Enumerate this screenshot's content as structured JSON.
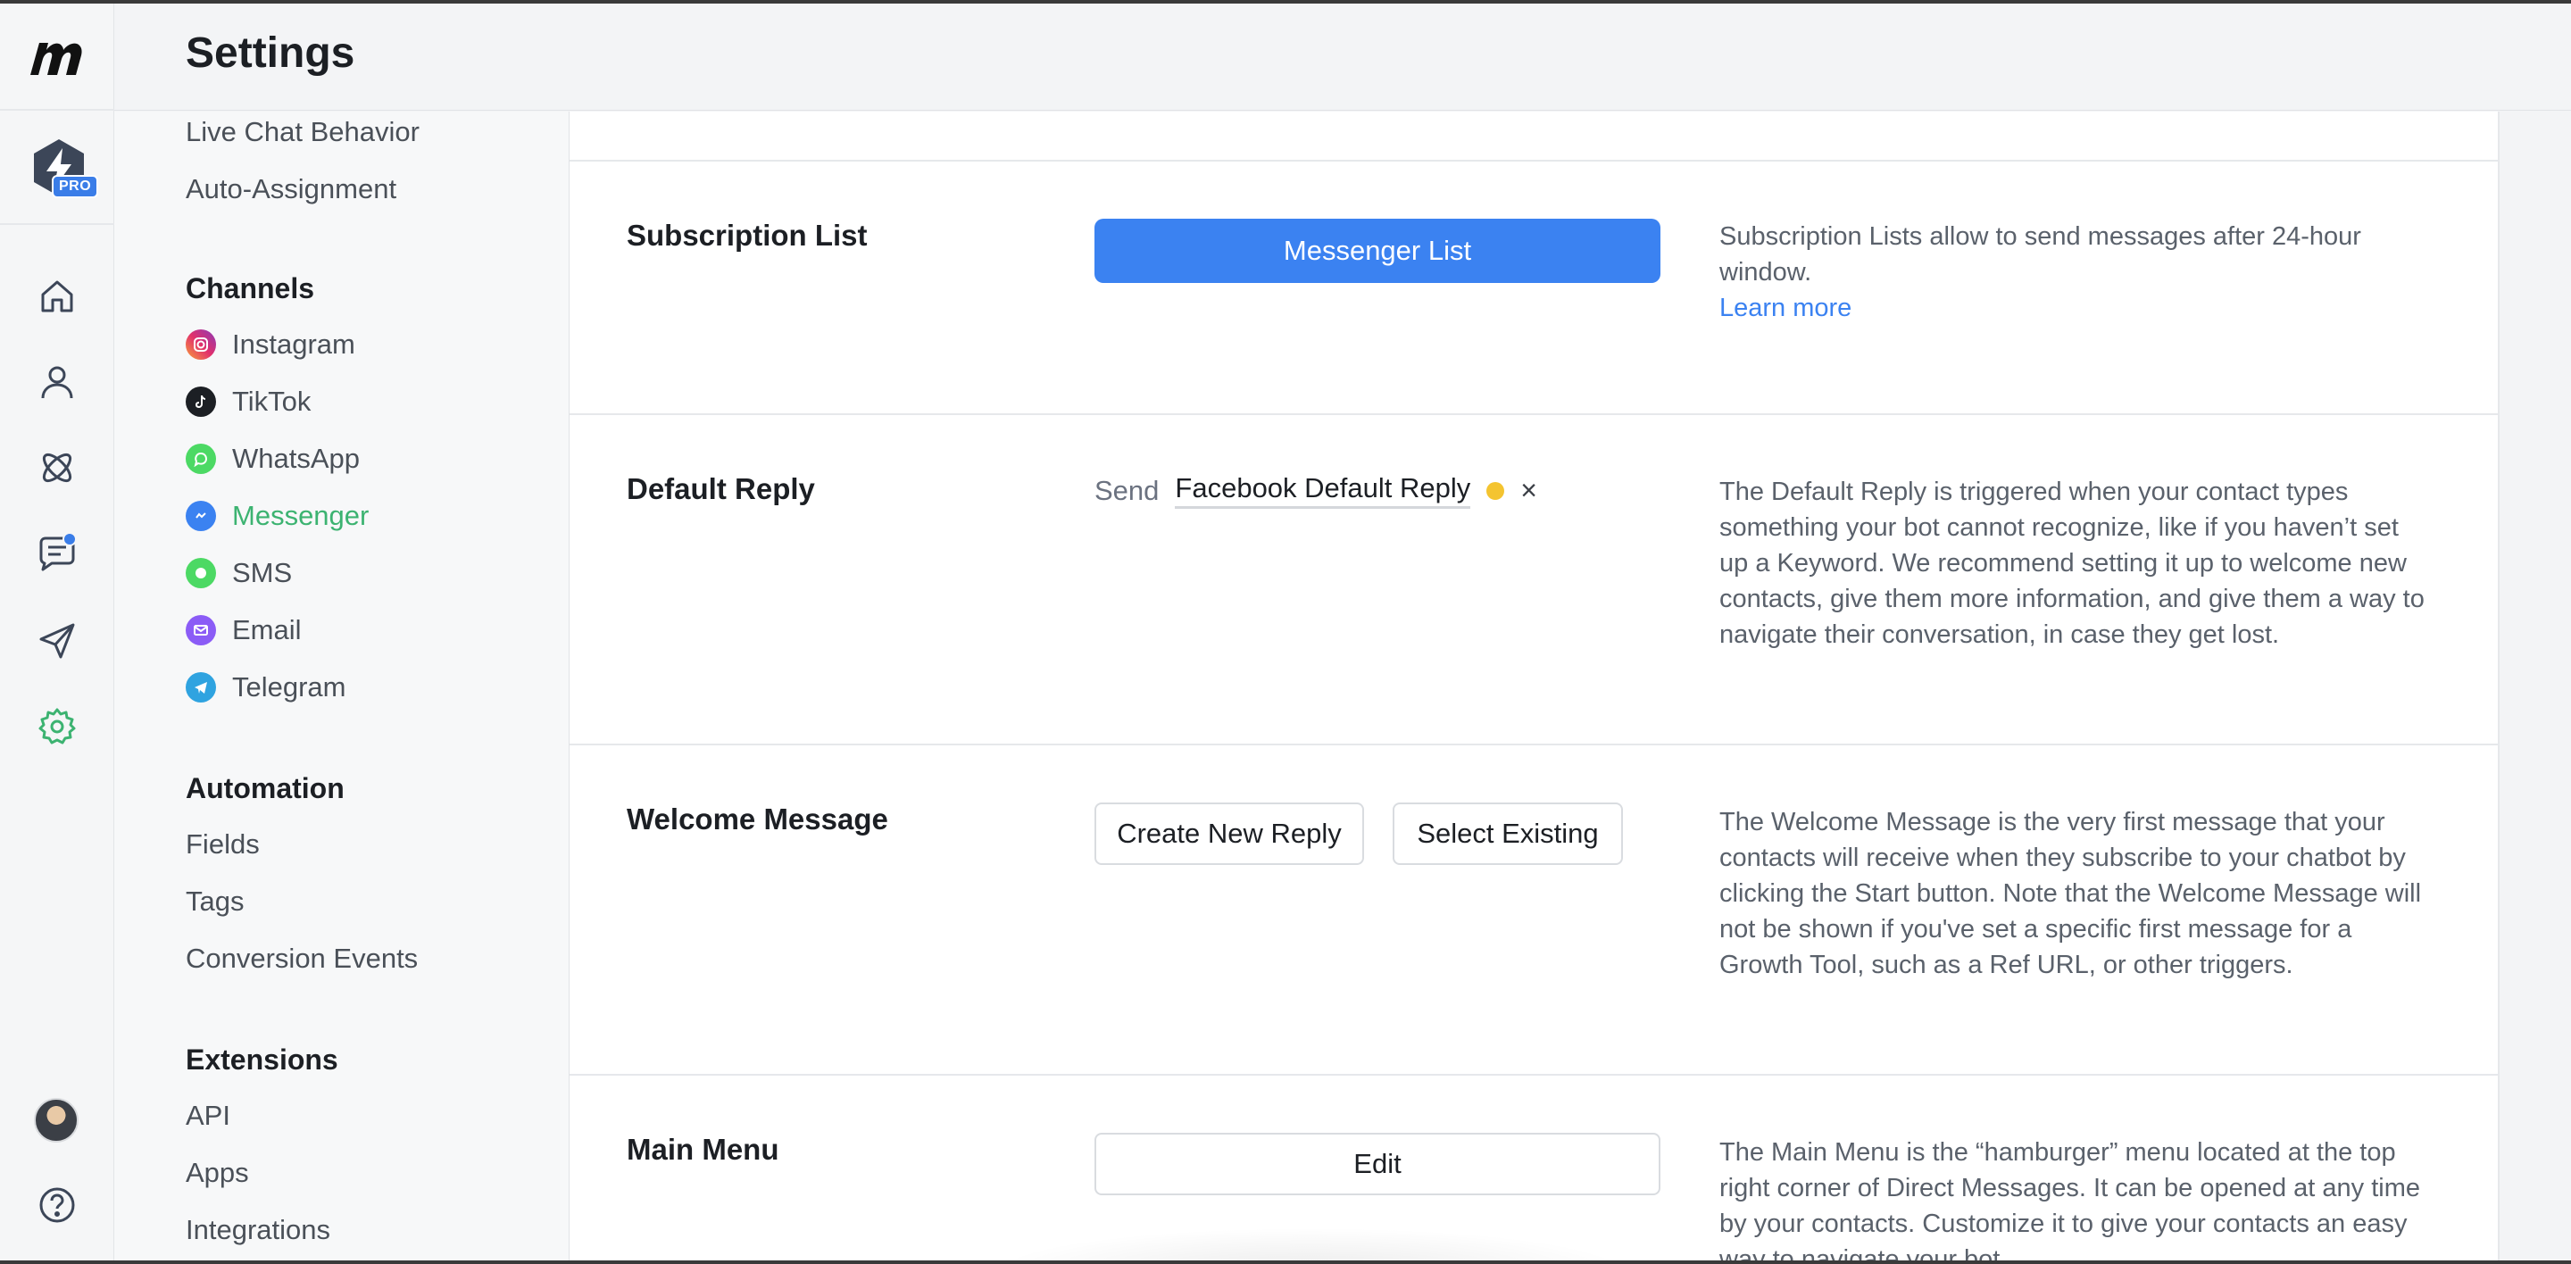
{
  "header": {
    "title": "Settings"
  },
  "rail": {
    "pro_badge": "PRO",
    "icons": [
      "home-icon",
      "contacts-icon",
      "automation-icon",
      "chat-icon",
      "broadcast-icon",
      "settings-icon",
      "help-icon"
    ],
    "accent_color": "#3cb371"
  },
  "nav": {
    "top_items": [
      "Live Chat Behavior",
      "Auto-Assignment"
    ],
    "channels_heading": "Channels",
    "channels": [
      {
        "label": "Instagram",
        "icon": "instagram-icon",
        "color": "#e1306c"
      },
      {
        "label": "TikTok",
        "icon": "tiktok-icon",
        "color": "#1c1f24"
      },
      {
        "label": "WhatsApp",
        "icon": "whatsapp-icon",
        "color": "#4cd964"
      },
      {
        "label": "Messenger",
        "icon": "messenger-icon",
        "color": "#3b82f1",
        "active": true
      },
      {
        "label": "SMS",
        "icon": "sms-icon",
        "color": "#4cd964"
      },
      {
        "label": "Email",
        "icon": "email-icon",
        "color": "#8b5cf6"
      },
      {
        "label": "Telegram",
        "icon": "telegram-icon",
        "color": "#2fa3e0"
      }
    ],
    "automation_heading": "Automation",
    "automation": [
      "Fields",
      "Tags",
      "Conversion Events"
    ],
    "extensions_heading": "Extensions",
    "extensions": [
      "API",
      "Apps",
      "Integrations"
    ]
  },
  "main": {
    "subscription": {
      "label": "Subscription List",
      "button": "Messenger List",
      "desc": "Subscription Lists allow to send messages after 24-hour window.",
      "learn_more": "Learn more"
    },
    "default_reply": {
      "label": "Default Reply",
      "send": "Send",
      "reply_name": "Facebook Default Reply",
      "close": "×",
      "desc": "The Default Reply is triggered when your contact types something your bot cannot recognize, like if you haven’t set up a Keyword. We recommend setting it up to welcome new contacts, give them more information, and give them a way to navigate their conversation, in case they get lost."
    },
    "welcome": {
      "label": "Welcome Message",
      "create_button": "Create New Reply",
      "select_button": "Select Existing",
      "desc": "The Welcome Message is the very first message that your contacts will receive when they subscribe to your chatbot by clicking the Start button. Note that the Welcome Message will not be shown if you've set a specific first message for a Growth Tool, such as a Ref URL, or other triggers."
    },
    "main_menu": {
      "label": "Main Menu",
      "edit_button": "Edit",
      "desc": "The Main Menu is the “hamburger” menu located at the top right corner of Direct Messages. It can be opened at any time by your contacts. Customize it to give your contacts an easy way to navigate your bot."
    }
  }
}
